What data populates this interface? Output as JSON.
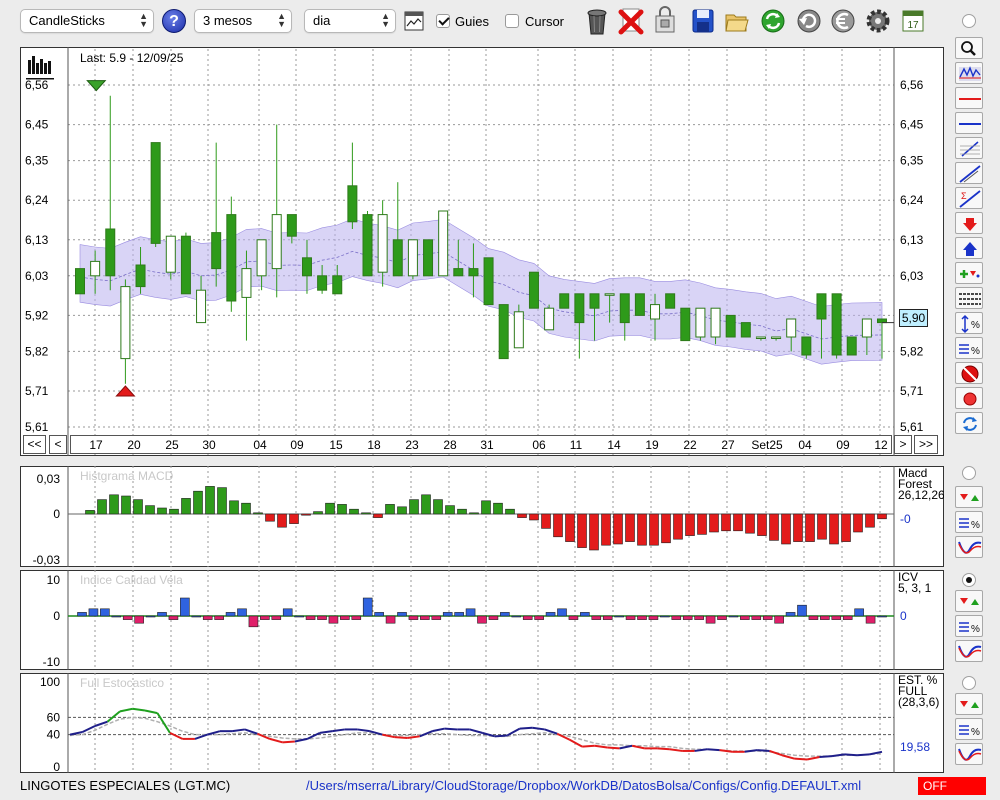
{
  "toolbar": {
    "chart_type": "CandleSticks",
    "period": "3 mesos",
    "interval": "dia",
    "guides_label": "Guies",
    "guides_checked": true,
    "cursor_label": "Cursor",
    "cursor_checked": false,
    "help_label": "?",
    "icons": [
      "help-icon",
      "chart-window-icon",
      "trash-icon",
      "delete-icon",
      "lock-file-icon",
      "save-icon",
      "open-folder-icon",
      "refresh-icon",
      "reload-icon",
      "euro-icon",
      "gear-icon",
      "calendar-icon"
    ],
    "calendar_day": "17"
  },
  "main_chart": {
    "last_label": "Last: 5.9 - 12/09/25",
    "y_ticks": [
      "6,56",
      "6,45",
      "6,35",
      "6,24",
      "6,13",
      "6,03",
      "5,92",
      "5,82",
      "5,71",
      "5,61"
    ],
    "x_ticks": [
      "17",
      "20",
      "25",
      "30",
      "04",
      "09",
      "15",
      "18",
      "23",
      "28",
      "31",
      "06",
      "11",
      "14",
      "19",
      "22",
      "27",
      "Set25",
      "04",
      "09",
      "12"
    ],
    "current_price": "5,90",
    "nav": {
      "first": "<<",
      "prev": "<",
      "next": ">",
      "last": ">>"
    },
    "colors": {
      "up_candle": "#ffffff",
      "down_candle": "#2e9a1a",
      "band": "#b9b0ee"
    }
  },
  "chart_data": [
    {
      "type": "candlestick",
      "title": "Last: 5.9 - 12/09/25",
      "ylim": [
        5.61,
        6.61
      ],
      "candles": [
        {
          "o": 6.05,
          "h": 6.05,
          "l": 5.98,
          "c": 5.98
        },
        {
          "o": 6.03,
          "h": 6.1,
          "l": 5.98,
          "c": 6.07
        },
        {
          "o": 6.16,
          "h": 6.53,
          "l": 5.99,
          "c": 6.03
        },
        {
          "o": 5.8,
          "h": 6.02,
          "l": 5.73,
          "c": 6.0
        },
        {
          "o": 6.06,
          "h": 6.11,
          "l": 5.98,
          "c": 6.0
        },
        {
          "o": 6.4,
          "h": 6.4,
          "l": 6.11,
          "c": 6.12
        },
        {
          "o": 6.04,
          "h": 6.14,
          "l": 6.02,
          "c": 6.14
        },
        {
          "o": 6.14,
          "h": 6.15,
          "l": 5.98,
          "c": 5.98
        },
        {
          "o": 5.9,
          "h": 6.03,
          "l": 5.9,
          "c": 5.99
        },
        {
          "o": 6.15,
          "h": 6.4,
          "l": 6.0,
          "c": 6.05
        },
        {
          "o": 6.2,
          "h": 6.25,
          "l": 5.93,
          "c": 5.96
        },
        {
          "o": 5.97,
          "h": 6.1,
          "l": 5.85,
          "c": 6.05
        },
        {
          "o": 6.03,
          "h": 6.13,
          "l": 5.99,
          "c": 6.13
        },
        {
          "o": 6.05,
          "h": 6.45,
          "l": 5.97,
          "c": 6.2
        },
        {
          "o": 6.2,
          "h": 6.2,
          "l": 6.12,
          "c": 6.14
        },
        {
          "o": 6.08,
          "h": 6.13,
          "l": 5.98,
          "c": 6.03
        },
        {
          "o": 6.03,
          "h": 6.06,
          "l": 5.98,
          "c": 5.99
        },
        {
          "o": 6.03,
          "h": 6.06,
          "l": 5.98,
          "c": 5.98
        },
        {
          "o": 6.28,
          "h": 6.4,
          "l": 6.16,
          "c": 6.18
        },
        {
          "o": 6.2,
          "h": 6.21,
          "l": 6.03,
          "c": 6.03
        },
        {
          "o": 6.04,
          "h": 6.24,
          "l": 6.0,
          "c": 6.2
        },
        {
          "o": 6.13,
          "h": 6.29,
          "l": 6.03,
          "c": 6.03
        },
        {
          "o": 6.03,
          "h": 6.13,
          "l": 6.02,
          "c": 6.13
        },
        {
          "o": 6.13,
          "h": 6.13,
          "l": 6.03,
          "c": 6.03
        },
        {
          "o": 6.03,
          "h": 6.21,
          "l": 6.03,
          "c": 6.21
        },
        {
          "o": 6.05,
          "h": 6.13,
          "l": 6.03,
          "c": 6.03
        },
        {
          "o": 6.05,
          "h": 6.12,
          "l": 5.97,
          "c": 6.03
        },
        {
          "o": 6.08,
          "h": 6.08,
          "l": 5.95,
          "c": 5.95
        },
        {
          "o": 5.95,
          "h": 5.95,
          "l": 5.8,
          "c": 5.8
        },
        {
          "o": 5.83,
          "h": 5.95,
          "l": 5.83,
          "c": 5.93
        },
        {
          "o": 6.04,
          "h": 6.04,
          "l": 5.94,
          "c": 5.94
        },
        {
          "o": 5.88,
          "h": 5.95,
          "l": 5.88,
          "c": 5.94
        },
        {
          "o": 5.98,
          "h": 5.98,
          "l": 5.94,
          "c": 5.94
        },
        {
          "o": 5.98,
          "h": 5.98,
          "l": 5.8,
          "c": 5.9
        },
        {
          "o": 5.98,
          "h": 5.98,
          "l": 5.85,
          "c": 5.94
        },
        {
          "o": 5.98,
          "h": 5.98,
          "l": 5.9,
          "c": 5.98
        },
        {
          "o": 5.98,
          "h": 5.98,
          "l": 5.85,
          "c": 5.9
        },
        {
          "o": 5.98,
          "h": 5.98,
          "l": 5.92,
          "c": 5.92
        },
        {
          "o": 5.91,
          "h": 5.98,
          "l": 5.85,
          "c": 5.95
        },
        {
          "o": 5.98,
          "h": 5.98,
          "l": 5.94,
          "c": 5.94
        },
        {
          "o": 5.94,
          "h": 5.94,
          "l": 5.85,
          "c": 5.85
        },
        {
          "o": 5.86,
          "h": 5.94,
          "l": 5.85,
          "c": 5.94
        },
        {
          "o": 5.86,
          "h": 5.94,
          "l": 5.84,
          "c": 5.94
        },
        {
          "o": 5.92,
          "h": 5.92,
          "l": 5.86,
          "c": 5.86
        },
        {
          "o": 5.9,
          "h": 5.9,
          "l": 5.86,
          "c": 5.86
        },
        {
          "o": 5.86,
          "h": 5.86,
          "l": 5.85,
          "c": 5.86
        },
        {
          "o": 5.86,
          "h": 5.86,
          "l": 5.85,
          "c": 5.86
        },
        {
          "o": 5.86,
          "h": 5.91,
          "l": 5.82,
          "c": 5.91
        },
        {
          "o": 5.86,
          "h": 5.86,
          "l": 5.8,
          "c": 5.81
        },
        {
          "o": 5.98,
          "h": 5.98,
          "l": 5.8,
          "c": 5.91
        },
        {
          "o": 5.98,
          "h": 5.98,
          "l": 5.8,
          "c": 5.81
        },
        {
          "o": 5.86,
          "h": 5.86,
          "l": 5.81,
          "c": 5.81
        },
        {
          "o": 5.86,
          "h": 5.91,
          "l": 5.81,
          "c": 5.91
        },
        {
          "o": 5.91,
          "h": 5.91,
          "l": 5.8,
          "c": 5.9
        }
      ],
      "markers": [
        {
          "type": "down-triangle",
          "at": 6.55,
          "candle": 2
        },
        {
          "type": "up-triangle",
          "at": 5.71,
          "candle": 3
        }
      ]
    },
    {
      "type": "bar",
      "title": "Histgrama MACD",
      "ylabel": "",
      "y_ticks": [
        "0,03",
        "0",
        "-0,03"
      ],
      "ylim": [
        -0.035,
        0.035
      ],
      "legend": [
        "Macd",
        "Forest",
        "26,12,26"
      ],
      "current_value": "-0",
      "values": [
        0.003,
        0.012,
        0.016,
        0.015,
        0.012,
        0.007,
        0.005,
        0.004,
        0.013,
        0.019,
        0.023,
        0.022,
        0.011,
        0.009,
        0.001,
        -0.006,
        -0.011,
        -0.008,
        -0.001,
        0.002,
        0.009,
        0.008,
        0.004,
        0.001,
        -0.003,
        0.008,
        0.006,
        0.012,
        0.016,
        0.012,
        0.007,
        0.004,
        0.001,
        0.011,
        0.009,
        0.004,
        -0.003,
        -0.005,
        -0.012,
        -0.019,
        -0.023,
        -0.028,
        -0.03,
        -0.026,
        -0.025,
        -0.023,
        -0.026,
        -0.026,
        -0.024,
        -0.021,
        -0.018,
        -0.017,
        -0.015,
        -0.014,
        -0.014,
        -0.016,
        -0.018,
        -0.022,
        -0.025,
        -0.023,
        -0.023,
        -0.021,
        -0.025,
        -0.023,
        -0.015,
        -0.011,
        -0.004
      ]
    },
    {
      "type": "bar",
      "title": "Indice Calidad Vela",
      "y_ticks": [
        "10",
        "0",
        "-10"
      ],
      "ylim": [
        -10,
        10
      ],
      "legend": [
        "ICV",
        "5, 3, 1"
      ],
      "current_value": "0",
      "values": [
        1,
        2,
        2,
        0,
        -1,
        -2,
        0,
        1,
        -1,
        5,
        0,
        -1,
        -1,
        1,
        2,
        -3,
        -1,
        -1,
        2,
        0,
        -1,
        -1,
        -2,
        -1,
        -1,
        5,
        1,
        -2,
        1,
        -1,
        -1,
        -1,
        1,
        1,
        2,
        -2,
        -1,
        1,
        0,
        -1,
        -1,
        1,
        2,
        -1,
        1,
        -1,
        -1,
        0,
        -1,
        -1,
        -1,
        0,
        -1,
        -1,
        -1,
        -2,
        -1,
        0,
        -1,
        -1,
        -1,
        -2,
        1,
        3,
        -1,
        -1,
        -1,
        -1,
        2,
        -2,
        0
      ]
    },
    {
      "type": "line",
      "title": "Full Estocastico",
      "y_ticks": [
        "100",
        "60",
        "40",
        "0"
      ],
      "ylim": [
        0,
        100
      ],
      "legend": [
        "EST. %",
        "FULL",
        "(28,3,6)"
      ],
      "current_value": "19,58",
      "series": [
        {
          "name": "%K",
          "values": [
            40,
            43,
            50,
            55,
            67,
            70,
            68,
            65,
            42,
            35,
            35,
            40,
            44,
            44,
            46,
            41,
            35,
            31,
            32,
            35,
            42,
            44,
            46,
            46,
            44,
            40,
            37,
            36,
            38,
            44,
            47,
            46,
            46,
            42,
            38,
            39,
            47,
            48,
            46,
            41,
            34,
            26,
            27,
            25,
            24,
            27,
            24,
            24,
            23,
            21,
            21,
            23,
            22,
            20,
            20,
            22,
            21,
            16,
            12,
            11,
            14,
            15,
            17,
            16,
            17,
            20
          ]
        },
        {
          "name": "%D",
          "values": [
            39,
            40,
            45,
            52,
            58,
            60,
            59,
            55,
            50,
            44,
            40,
            40,
            40,
            41,
            42,
            40,
            38,
            36,
            35,
            35,
            36,
            38,
            40,
            42,
            42,
            40,
            39,
            39,
            40,
            41,
            41,
            40,
            39,
            39,
            38,
            38,
            40,
            41,
            42,
            40,
            38,
            34,
            30,
            28,
            28,
            27,
            27,
            26,
            26,
            24,
            23,
            23,
            22,
            21,
            21,
            21,
            20,
            18,
            16,
            15,
            15,
            15,
            16,
            16,
            17,
            18
          ]
        }
      ]
    }
  ],
  "macd_panel": {
    "title": "Histgrama MACD",
    "y_ticks": [
      "0,03",
      "0",
      "-0,03"
    ],
    "legend_1": "Macd",
    "legend_2": "Forest",
    "legend_3": "26,12,26",
    "value": "-0"
  },
  "icv_panel": {
    "title": "Indice Calidad Vela",
    "y_ticks": [
      "10",
      "0",
      "-10"
    ],
    "legend_1": "ICV",
    "legend_2": "5, 3, 1",
    "value": "0"
  },
  "stoch_panel": {
    "title": "Full Estocastico",
    "y_ticks": [
      "100",
      "60",
      "40",
      "0"
    ],
    "legend_1": "EST. %",
    "legend_2": "FULL",
    "legend_3": "(28,3,6)",
    "value": "19,58"
  },
  "side_tools": [
    "zoom-icon",
    "chart-bars-icon",
    "red-horizontal-line-icon",
    "blue-horizontal-line-icon",
    "fibonacci-icon",
    "trend-line-icon",
    "sigma-line-icon",
    "down-arrow-icon",
    "up-arrow-icon",
    "add-signal-icon",
    "grid-lines-icon",
    "scale-percent-icon",
    "compare-percent-icon",
    "stop-icon",
    "record-icon",
    "refresh-icon"
  ],
  "status": {
    "instrument": "LINGOTES ESPECIALES (LGT.MC)",
    "path": "/Users/mserra/Library/CloudStorage/Dropbox/WorkDB/DatosBolsa/Configs/Config.DEFAULT.xml",
    "mode": "OFF"
  }
}
